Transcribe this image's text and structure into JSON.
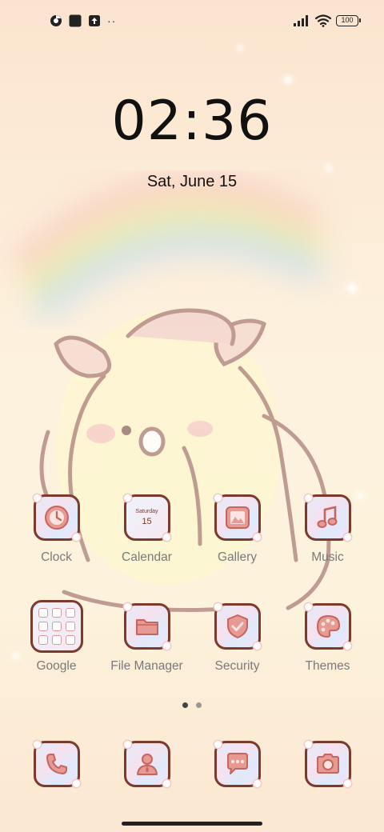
{
  "status_bar": {
    "icons_left": [
      "chrome-app-icon",
      "square-notification-icon",
      "upload-notification-icon"
    ],
    "overflow_dots": "··",
    "icons_right": [
      "signal-icon",
      "wifi-icon"
    ],
    "battery": "100"
  },
  "clock": {
    "time": "02:36",
    "date": "Sat, June 15"
  },
  "calendar_icon": {
    "weekday": "Saturday",
    "day": "15"
  },
  "apps_row1": [
    {
      "label": "Clock",
      "icon": "clock-icon"
    },
    {
      "label": "Calendar",
      "icon": "calendar-icon"
    },
    {
      "label": "Gallery",
      "icon": "gallery-icon"
    },
    {
      "label": "Music",
      "icon": "music-note-icon"
    }
  ],
  "apps_row2": [
    {
      "label": "Google",
      "icon": "google-folder-icon"
    },
    {
      "label": "File Manager",
      "icon": "folder-icon"
    },
    {
      "label": "Security",
      "icon": "shield-check-icon"
    },
    {
      "label": "Themes",
      "icon": "palette-icon"
    }
  ],
  "dock": [
    {
      "icon": "phone-icon"
    },
    {
      "icon": "contacts-icon"
    },
    {
      "icon": "messages-icon"
    },
    {
      "icon": "camera-icon"
    }
  ],
  "page_indicator": {
    "pages": 2,
    "active": 0
  },
  "colors": {
    "icon_border": "#7c3a2c",
    "icon_glyph": "#e48c8c",
    "label": "#7a7a7a"
  }
}
